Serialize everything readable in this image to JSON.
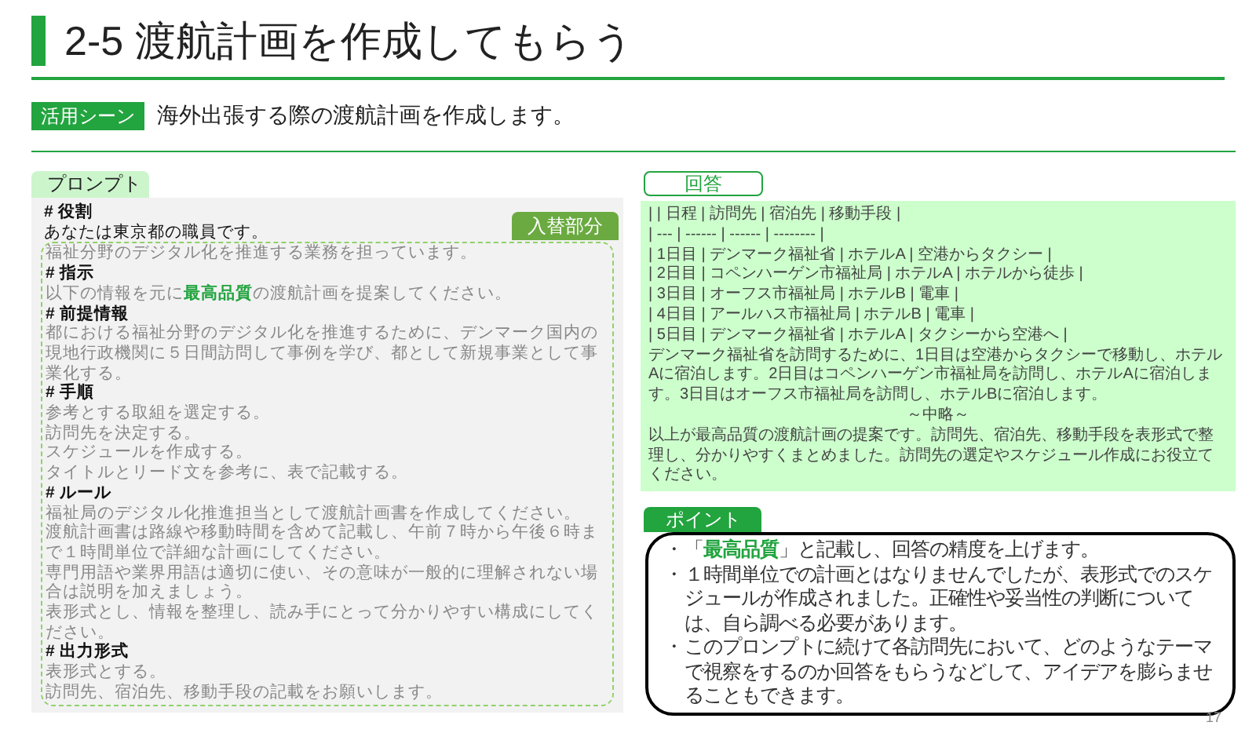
{
  "title": "2-5 渡航計画を作成してもらう",
  "scene": {
    "badge": "活用シーン",
    "text": "海外出張する際の渡航計画を作成します。"
  },
  "prompt": {
    "label": "プロンプト",
    "lines": [
      {
        "kind": "heading",
        "text": "# 役割"
      },
      {
        "kind": "plain",
        "text": "あなたは東京都の職員です。"
      }
    ],
    "replaced_label": "入替部分",
    "replaced_lines": [
      {
        "kind": "body",
        "text": "福祉分野のデジタル化を推進する業務を担っています。"
      },
      {
        "kind": "heading",
        "text": "# 指示"
      },
      {
        "kind": "body",
        "text": "以下の情報を元に**最高品質**の渡航計画を提案してください。"
      },
      {
        "kind": "heading",
        "text": "# 前提情報"
      },
      {
        "kind": "body",
        "text": "都における福祉分野のデジタル化を推進するために、デンマーク国内の現地行政機関に５日間訪問して事例を学び、都として新規事業として事業化する。"
      },
      {
        "kind": "heading",
        "text": "# 手順"
      },
      {
        "kind": "body",
        "text": "参考とする取組を選定する。"
      },
      {
        "kind": "body",
        "text": "訪問先を決定する。"
      },
      {
        "kind": "body",
        "text": "スケジュールを作成する。"
      },
      {
        "kind": "body",
        "text": "タイトルとリード文を参考に、表で記載する。"
      },
      {
        "kind": "heading",
        "text": "# ルール"
      },
      {
        "kind": "body",
        "text": "福祉局のデジタル化推進担当として渡航計画書を作成してください。"
      },
      {
        "kind": "body",
        "text": "渡航計画書は路線や移動時間を含めて記載し、午前７時から午後６時まで１時間単位で詳細な計画にしてください。"
      },
      {
        "kind": "body",
        "text": "専門用語や業界用語は適切に使い、その意味が一般的に理解されない場合は説明を加えましょう。"
      },
      {
        "kind": "body",
        "text": "表形式とし、情報を整理し、読み手にとって分かりやすい構成にしてください。"
      },
      {
        "kind": "heading",
        "text": "# 出力形式"
      },
      {
        "kind": "body",
        "text": "表形式とする。"
      },
      {
        "kind": "body",
        "text": "訪問先、宿泊先、移動手段の記載をお願いします。"
      }
    ]
  },
  "answer": {
    "label": "回答",
    "lines": [
      {
        "kind": "text",
        "text": "| | 日程 | 訪問先 | 宿泊先 | 移動手段 |"
      },
      {
        "kind": "text",
        "text": "| --- | ------ | ------ | -------- |"
      },
      {
        "kind": "text",
        "text": "| 1日目 | デンマーク福祉省 | ホテルA | 空港からタクシー |"
      },
      {
        "kind": "text",
        "text": "| 2日目 | コペンハーゲン市福祉局 | ホテルA | ホテルから徒歩 |"
      },
      {
        "kind": "text",
        "text": "| 3日目 | オーフス市福祉局 | ホテルB | 電車 |"
      },
      {
        "kind": "text",
        "text": "| 4日目 | アールハス市福祉局 | ホテルB | 電車 |"
      },
      {
        "kind": "text",
        "text": "| 5日目 | デンマーク福祉省 | ホテルA | タクシーから空港へ |"
      },
      {
        "kind": "text",
        "text": "デンマーク福祉省を訪問するために、1日目は空港からタクシーで移動し、ホテルAに宿泊します。2日目はコペンハーゲン市福祉局を訪問し、ホテルAに宿泊します。3日目はオーフス市福祉局を訪問し、ホテルBに宿泊します。"
      },
      {
        "kind": "center",
        "text": "～中略～"
      },
      {
        "kind": "text",
        "text": "以上が最高品質の渡航計画の提案です。訪問先、宿泊先、移動手段を表形式で整理し、分かりやすくまとめました。訪問先の選定やスケジュール作成にお役立てください。"
      }
    ]
  },
  "point": {
    "label": "ポイント",
    "items": [
      {
        "bullet": "・",
        "text": "「**最高品質**」と記載し、回答の精度を上げます。"
      },
      {
        "bullet": "・",
        "text": "１時間単位での計画とはなりませんでしたが、表形式でのスケジュールが作成されました。正確性や妥当性の判断については、自ら調べる必要があります。"
      },
      {
        "bullet": "・",
        "text": "このプロンプトに続けて各訪問先において、どのようなテーマで視察をするのか回答をもらうなどして、アイデアを膨らませることもできます。"
      }
    ]
  },
  "page_number": "17"
}
